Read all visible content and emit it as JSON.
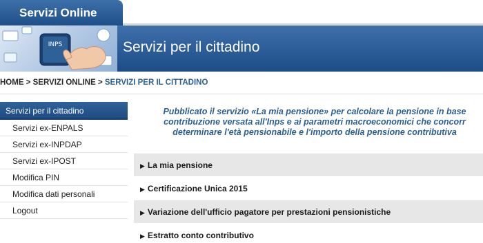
{
  "header": {
    "tab_label": "Servizi Online",
    "banner_title": "Servizi per il cittadino",
    "banner_logo_text": "INPS"
  },
  "breadcrumb": {
    "home": "HOME",
    "separator": " > ",
    "section": "SERVIZI ONLINE",
    "current": "SERVIZI PER IL CITTADINO"
  },
  "sidebar": {
    "active": "Servizi per il cittadino",
    "items": [
      {
        "label": "Servizi ex-ENPALS"
      },
      {
        "label": "Servizi ex-INPDAP"
      },
      {
        "label": "Servizi ex-IPOST"
      },
      {
        "label": "Modifica PIN"
      },
      {
        "label": "Modifica dati personali"
      },
      {
        "label": "Logout"
      }
    ]
  },
  "intro": {
    "line1": "Pubblicato il servizio «La mia pensione» per calcolare la pensione in base",
    "line2": "contribuzione versata all'Inps e ai parametri macroeconomici che concorr",
    "line3": "determinare l'età pensionabile e l'importo della pensione contributiva"
  },
  "accordion": {
    "items": [
      {
        "label": "La mia pensione"
      },
      {
        "label": "Certificazione Unica 2015"
      },
      {
        "label": "Variazione dell'ufficio pagatore per prestazioni pensionistiche"
      },
      {
        "label": "Estratto conto contributivo"
      }
    ]
  },
  "colors": {
    "brand_blue": "#1f4f89",
    "link_blue": "#2b5f93",
    "row_shade": "#e7e7e7"
  },
  "icons": {
    "accordion_arrow": "triangle-right-icon"
  }
}
